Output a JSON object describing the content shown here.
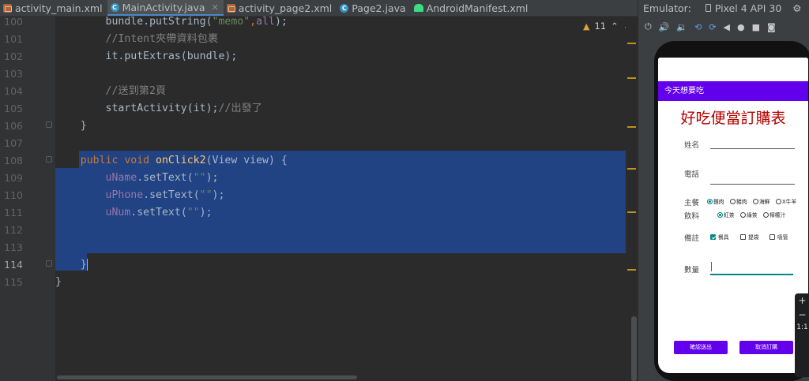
{
  "tabs": [
    {
      "label": "activity_main.xml",
      "icon": "xml-file-icon",
      "active": false
    },
    {
      "label": "MainActivity.java",
      "icon": "java-class-icon",
      "active": true
    },
    {
      "label": "activity_page2.xml",
      "icon": "xml-file-icon",
      "active": false
    },
    {
      "label": "Page2.java",
      "icon": "java-class-icon",
      "active": false
    },
    {
      "label": "AndroidManifest.xml",
      "icon": "android-manifest-icon",
      "active": false
    }
  ],
  "editor": {
    "line_numbers": [
      "100",
      "101",
      "102",
      "103",
      "104",
      "105",
      "106",
      "107",
      "108",
      "109",
      "110",
      "111",
      "112",
      "113",
      "114",
      "115"
    ],
    "current_line": "114",
    "warnings_count": "11",
    "code": {
      "l100_a": "bundle.putString(",
      "l100_b": "\"memo\"",
      "l100_c": ",",
      "l100_d": "all",
      "l100_e": ");",
      "l101": "//Intent夾帶資料包裹",
      "l102": "it.putExtras(bundle);",
      "l104": "//送到第2頁",
      "l105_a": "startActivity(it);",
      "l105_b": "//出發了",
      "l106": "}",
      "l108_kw": "public void ",
      "l108_fn": "onClick2",
      "l108_rest": "(View view) {",
      "l109_a": "uName",
      "l109_b": ".setText(",
      "l109_c": "\"\"",
      "l109_d": ");",
      "l110_a": "uPhone",
      "l110_b": ".setText(",
      "l110_c": "\"\"",
      "l110_d": ");",
      "l111_a": "uNum",
      "l111_b": ".setText(",
      "l111_c": "\"\"",
      "l111_d": ");",
      "l114": "}",
      "l115": "}"
    }
  },
  "emulator": {
    "label": "Emulator:",
    "device": "Pixel 4 API 30",
    "app": {
      "toolbar_title": "今天想要吃",
      "title": "好吃便當訂購表",
      "name_label": "姓名",
      "phone_label": "電話",
      "main_label": "主餐",
      "main_options": [
        "雞肉",
        "豬肉",
        "海鮮",
        "X牛羊"
      ],
      "drink_label": "飲料",
      "drink_options": [
        "紅茶",
        "綠茶",
        "檸檬汁"
      ],
      "note_label": "備註",
      "note_options": [
        "餐具",
        "提袋",
        "吸管"
      ],
      "qty_label": "數量",
      "confirm_button": "確認送出",
      "cancel_button": "取消訂購"
    },
    "zoom": {
      "plus": "+",
      "minus": "−",
      "ratio": "1:1"
    }
  },
  "colors": {
    "accent": "#6200ee",
    "teal": "#018786",
    "selection": "#214283",
    "title_red": "#b40000"
  }
}
